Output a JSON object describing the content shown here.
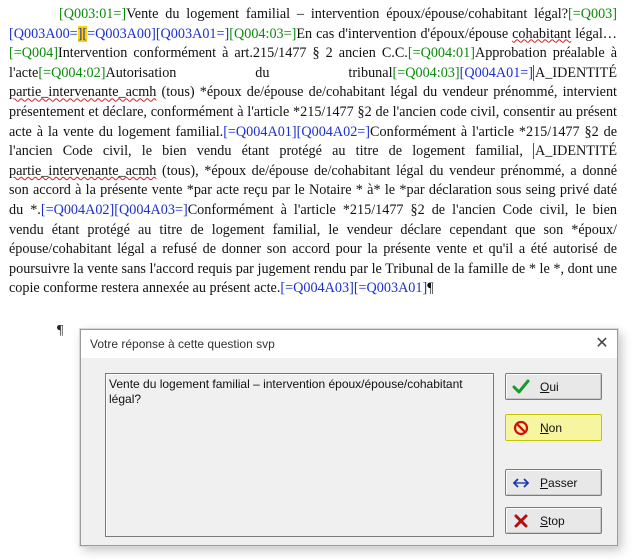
{
  "document": {
    "c1": "[Q003:01=]",
    "t1": "Vente du logement familial – intervention époux/épouse/cohabitant légal?",
    "c2": "[=Q003]",
    "c3": "[Q003A00=",
    "c3b": "][",
    "c3c": "=Q003A00]",
    "c4": "[Q003A01=]",
    "c5": "[Q004:03=]",
    "t2": "En cas d'intervention d'époux/épouse ",
    "t2sq": "cohabitant",
    "t2b": " légal…",
    "c6": "[=Q004]",
    "t3": "Intervention conformément à art.215/1477 § 2 ancien C.C.",
    "c7": "[=Q004:01]",
    "t4": "Approbation préalable à l'acte",
    "c8": "[=Q004:02]",
    "t5": "Autorisation du tribunal",
    "c9": "[=Q004:03]",
    "c10": "[Q004A01=]",
    "t6a": "A_IDENTITÉ",
    "t6b": "partie_intervenante_acmh",
    "t6c": " (tous)",
    "t6d": " *époux de/épouse de/cohabitant légal du vendeur prénommé, intervient présentement et déclare, conformément à l'article *215/1477 §2 de l'ancien code civil, consentir au présent acte à la vente du logement familial.",
    "c11": "[=Q004A01]",
    "c12": "[Q004A02=]",
    "t7": "Conformément à l'article *215/1477 §2 de l'ancien Code civil, le bien vendu étant protégé au titre de logement familial, ",
    "t7a": "A_IDENTITÉ",
    "t7b": "partie_intervenante_acmh",
    "t7c": " (tous)",
    "t7d": ", *époux de/épouse de/cohabitant légal du vendeur prénommé, a donné son accord à la présente vente *par acte reçu par le Notaire * à* le *par déclaration sous seing privé daté du *.",
    "c13": "[=Q004A02]",
    "c14": "[Q004A03=]",
    "t8": "Conformément à l'article *215/1477 §2 de l'ancien Code civil, le bien vendu étant protégé au titre de logement familial, le vendeur déclare cependant que son *époux/épouse/cohabitant légal a refusé de donner son accord pour la présente vente et qu'il a été autorisé de poursuivre la vente sans l'accord requis par jugement rendu par le Tribunal de la famille de * le *, dont une copie conforme restera annexée au présent acte.",
    "c15": "[=Q004A03]",
    "c16": "[=Q003A01]",
    "pilcrow": "¶"
  },
  "dialog": {
    "title": "Votre réponse à cette question svp",
    "close_glyph": "✕",
    "question": "Vente du logement familial – intervention époux/épouse/cohabitant légal?",
    "buttons": {
      "oui": {
        "u": "O",
        "rest": "ui"
      },
      "non": {
        "u": "N",
        "rest": "on"
      },
      "passer": {
        "u": "P",
        "rest": "asser"
      },
      "stop": {
        "u": "S",
        "rest": "top"
      }
    }
  },
  "colors": {
    "field_green": "#0a8a0a",
    "field_blue": "#1a2fd0",
    "highlight": "#ffd400",
    "focus_button": "#f6f6a0"
  }
}
